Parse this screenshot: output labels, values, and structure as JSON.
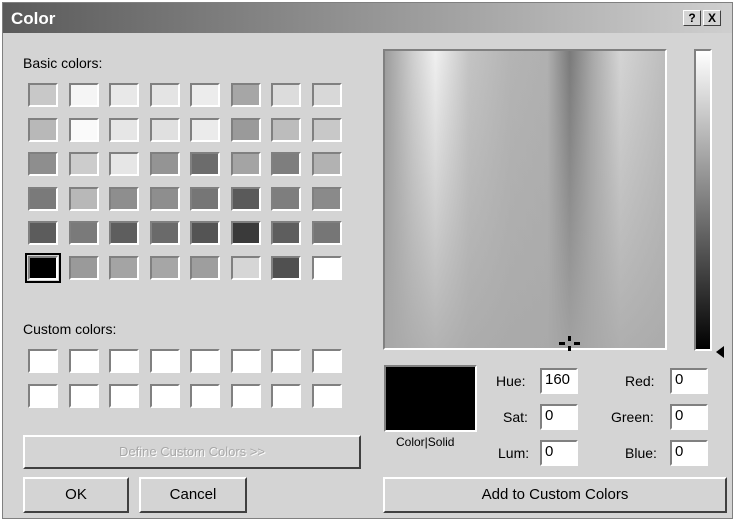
{
  "window": {
    "title": "Color",
    "help_label": "?",
    "close_label": "X"
  },
  "labels": {
    "basic_colors": "Basic colors:",
    "custom_colors": "Custom colors:",
    "color_solid": "Color|Solid",
    "hue": "Hue:",
    "sat": "Sat:",
    "lum": "Lum:",
    "red": "Red:",
    "green": "Green:",
    "blue": "Blue:"
  },
  "values": {
    "hue": "160",
    "sat": "0",
    "lum": "0",
    "red": "0",
    "green": "0",
    "blue": "0"
  },
  "buttons": {
    "define_custom": "Define Custom Colors >>",
    "ok": "OK",
    "cancel": "Cancel",
    "add_custom": "Add to Custom Colors"
  },
  "basic_colors": [
    [
      "#c8c8c8",
      "#f5f5f5",
      "#e8e8e8",
      "#e4e4e4",
      "#ececec",
      "#a6a6a6",
      "#dcdcdc",
      "#d8d8d8"
    ],
    [
      "#b8b8b8",
      "#fafafa",
      "#e6e6e6",
      "#e0e0e0",
      "#ebebeb",
      "#9a9a9a",
      "#bcbcbc",
      "#c8c8c8"
    ],
    [
      "#8e8e8e",
      "#cccccc",
      "#e6e6e6",
      "#949494",
      "#6c6c6c",
      "#a4a4a4",
      "#7e7e7e",
      "#b2b2b2"
    ],
    [
      "#7a7a7a",
      "#b8b8b8",
      "#8e8e8e",
      "#8e8e8e",
      "#767676",
      "#5a5a5a",
      "#7e7e7e",
      "#8a8a8a"
    ],
    [
      "#5c5c5c",
      "#7a7a7a",
      "#5e5e5e",
      "#6a6a6a",
      "#545454",
      "#3a3a3a",
      "#5e5e5e",
      "#767676"
    ],
    [
      "#000000",
      "#9a9a9a",
      "#a4a4a4",
      "#a6a6a6",
      "#9e9e9e",
      "#d6d6d6",
      "#505050",
      "#ffffff"
    ]
  ],
  "custom_colors": [
    [
      "#ffffff",
      "#ffffff",
      "#ffffff",
      "#ffffff",
      "#ffffff",
      "#ffffff",
      "#ffffff",
      "#ffffff"
    ],
    [
      "#ffffff",
      "#ffffff",
      "#ffffff",
      "#ffffff",
      "#ffffff",
      "#ffffff",
      "#ffffff",
      "#ffffff"
    ]
  ],
  "selected_basic": [
    5,
    0
  ],
  "colors": {
    "title_bar_left": "#5a5a5a",
    "dialog_bg": "#d4d4d4",
    "current_color": "#000000"
  }
}
